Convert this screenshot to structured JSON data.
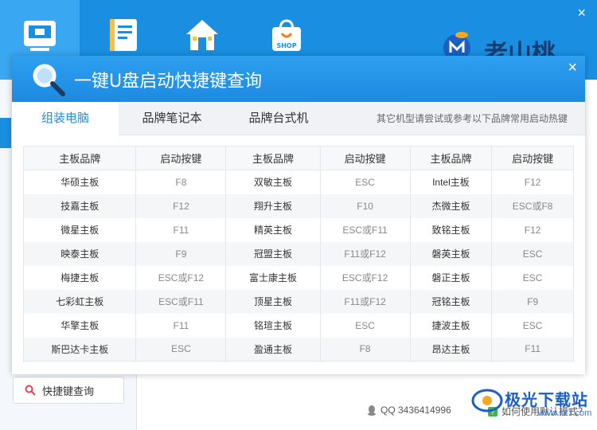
{
  "dialog": {
    "title": "一键U盘启动快捷键查询",
    "close_glyph": "×",
    "tabs": [
      {
        "label": "组装电脑"
      },
      {
        "label": "品牌笔记本"
      },
      {
        "label": "品牌台式机"
      }
    ],
    "hint": "其它机型请尝试或参考以下品牌常用启动热键",
    "table": {
      "headers": [
        "主板品牌",
        "启动按键",
        "主板品牌",
        "启动按键",
        "主板品牌",
        "启动按键"
      ],
      "rows": [
        [
          "华硕主板",
          "F8",
          "双敏主板",
          "ESC",
          "Intel主板",
          "F12"
        ],
        [
          "技嘉主板",
          "F12",
          "翔升主板",
          "F10",
          "杰微主板",
          "ESC或F8"
        ],
        [
          "微星主板",
          "F11",
          "精英主板",
          "ESC或F11",
          "致铭主板",
          "F12"
        ],
        [
          "映泰主板",
          "F9",
          "冠盟主板",
          "F11或F12",
          "磐英主板",
          "ESC"
        ],
        [
          "梅捷主板",
          "ESC或F12",
          "富士康主板",
          "ESC或F12",
          "磐正主板",
          "ESC"
        ],
        [
          "七彩虹主板",
          "ESC或F11",
          "顶星主板",
          "F11或F12",
          "冠铭主板",
          "F9"
        ],
        [
          "华擎主板",
          "F11",
          "铭瑄主板",
          "ESC",
          "捷波主板",
          "ESC"
        ],
        [
          "斯巴达卡主板",
          "ESC",
          "盈通主板",
          "F8",
          "昂达主板",
          "F11"
        ]
      ]
    }
  },
  "app": {
    "top_icons": [
      "computer-icon",
      "book-icon",
      "home-icon",
      "shop-icon"
    ],
    "shop_label": "SHOP",
    "logo_text": "老山桃",
    "close_glyph": "×",
    "quick_button": "快捷键查询",
    "qq": "QQ 3436414996",
    "mode_link": "如何使用默认模式？",
    "watermark_title": "极光下载站",
    "watermark_url": "www.xz7.com"
  },
  "colors": {
    "accent": "#1a8fe2",
    "header": "#2196e8",
    "active_tab_text": "#1a8fe2"
  }
}
